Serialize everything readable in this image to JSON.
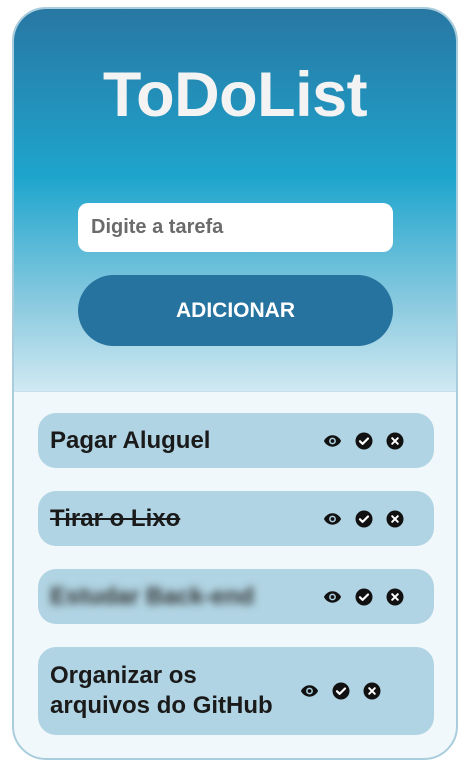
{
  "app": {
    "title": "ToDoList"
  },
  "form": {
    "input_placeholder": "Digite a tarefa",
    "input_value": "",
    "add_label": "ADICIONAR"
  },
  "tasks": [
    {
      "text": "Pagar Aluguel",
      "state": "normal"
    },
    {
      "text": "Tirar o Lixo",
      "state": "completed"
    },
    {
      "text": "Estudar Back-end",
      "state": "hidden"
    },
    {
      "text": "Organizar os arquivos do GitHub",
      "state": "normal"
    }
  ],
  "icons": {
    "view": "eye-icon",
    "complete": "check-circle-icon",
    "delete": "x-circle-icon"
  },
  "colors": {
    "accent": "#2773a0",
    "task_background": "#b0d4e3",
    "title_text": "#f3f3f3"
  }
}
